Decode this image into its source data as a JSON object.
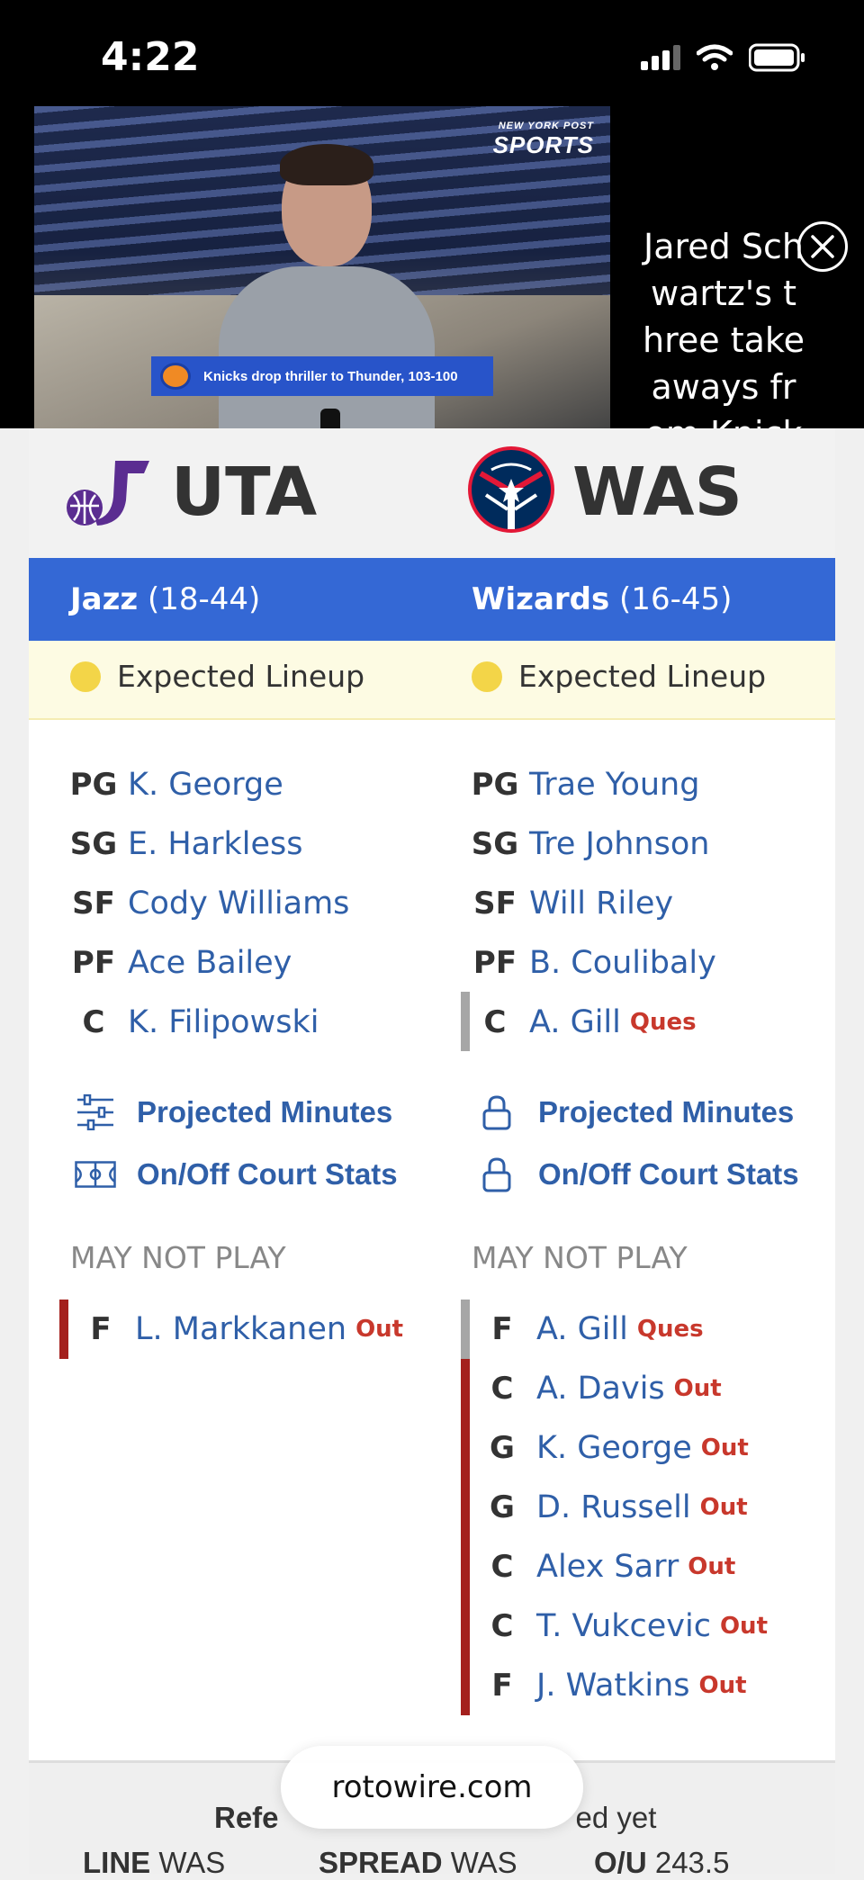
{
  "status_bar": {
    "time": "4:22"
  },
  "video": {
    "brand_line1": "NEW YORK POST",
    "brand_line2": "SPORTS",
    "lower_third": "Knicks drop thriller to Thunder, 103-100",
    "title": "Jared Schwartz's three takeaways from Knicks..."
  },
  "teams": {
    "away": {
      "abbr": "UTA",
      "name": "Jazz",
      "record": "(18-44)",
      "lineup_status": "Expected Lineup",
      "lineup": [
        {
          "pos": "PG",
          "name": "K. George",
          "tag": ""
        },
        {
          "pos": "SG",
          "name": "E. Harkless",
          "tag": ""
        },
        {
          "pos": "SF",
          "name": "Cody Williams",
          "tag": ""
        },
        {
          "pos": "PF",
          "name": "Ace Bailey",
          "tag": ""
        },
        {
          "pos": "C",
          "name": "K. Filipowski",
          "tag": ""
        }
      ],
      "links": [
        "Projected Minutes",
        "On/Off Court Stats"
      ],
      "may_not_play_label": "MAY NOT PLAY",
      "may_not_play": [
        {
          "pos": "F",
          "name": "L. Markkanen",
          "tag": "Out"
        }
      ]
    },
    "home": {
      "abbr": "WAS",
      "name": "Wizards",
      "record": "(16-45)",
      "lineup_status": "Expected Lineup",
      "lineup": [
        {
          "pos": "PG",
          "name": "Trae Young",
          "tag": ""
        },
        {
          "pos": "SG",
          "name": "Tre Johnson",
          "tag": ""
        },
        {
          "pos": "SF",
          "name": "Will Riley",
          "tag": ""
        },
        {
          "pos": "PF",
          "name": "B. Coulibaly",
          "tag": ""
        },
        {
          "pos": "C",
          "name": "A. Gill",
          "tag": "Ques"
        }
      ],
      "links": [
        "Projected Minutes",
        "On/Off Court Stats"
      ],
      "may_not_play_label": "MAY NOT PLAY",
      "may_not_play": [
        {
          "pos": "F",
          "name": "A. Gill",
          "tag": "Ques"
        },
        {
          "pos": "C",
          "name": "A. Davis",
          "tag": "Out"
        },
        {
          "pos": "G",
          "name": "K. George",
          "tag": "Out"
        },
        {
          "pos": "G",
          "name": "D. Russell",
          "tag": "Out"
        },
        {
          "pos": "C",
          "name": "Alex Sarr",
          "tag": "Out"
        },
        {
          "pos": "C",
          "name": "T. Vukcevic",
          "tag": "Out"
        },
        {
          "pos": "F",
          "name": "J. Watkins",
          "tag": "Out"
        }
      ]
    }
  },
  "footer": {
    "referees_label": "Refe",
    "referees_value": "ed yet",
    "line_label": "LINE",
    "line_value": "WAS",
    "spread_label": "SPREAD",
    "spread_value": "WAS",
    "ou_label": "O/U",
    "ou_value": "243.5"
  },
  "browser": {
    "url": "rotowire.com"
  },
  "colors": {
    "team_bar": "#3468d5",
    "link": "#2f5fa8",
    "out": "#c8382c",
    "ques_marker": "#a6a6a6",
    "out_marker": "#a4201d"
  }
}
